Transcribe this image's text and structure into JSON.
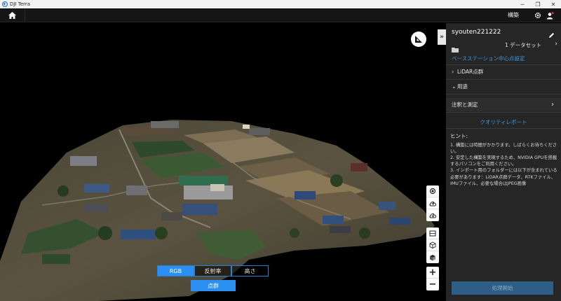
{
  "window": {
    "title": "DJI Terra",
    "icon": "dji-terra-logo-icon",
    "controls": [
      "minimize-icon",
      "restore-icon",
      "close-icon"
    ]
  },
  "topbar": {
    "home_icon": "home-icon",
    "menu_label": "構築",
    "settings_icon": "gear-icon",
    "account_icon": "user-icon",
    "notification_dot_color": "#e53935"
  },
  "viewport": {
    "compass_icon": "compass-icon",
    "collapse_label": "»",
    "view_tools": [
      "layers-icon",
      "cloud-upload-icon",
      "cloud-download-icon"
    ],
    "edit_tools": [
      "crop-icon",
      "cube-icon",
      "cube-solid-icon"
    ],
    "zoom_in_label": "+",
    "zoom_out_label": "−",
    "modes": [
      "RGB",
      "反射率",
      "高さ"
    ],
    "active_mode": "RGB",
    "pointcloud_label": "点群"
  },
  "panel": {
    "mission_name": "syouten221222",
    "edit_icon": "pencil-icon",
    "folder_icon": "folder-icon",
    "dataset_label": "1 データセット",
    "base_station_link": "ベースステーション中心点設定",
    "sections": [
      {
        "label": "LiDAR点群",
        "expanded": false
      },
      {
        "label": "用途",
        "expanded": true
      },
      {
        "label": "注釈と測定",
        "expanded": false
      }
    ],
    "quality_report_link": "クオリティレポート",
    "hint_title": "ヒント:",
    "hints": [
      "1. 構築には時間がかかります。しばらくお待ちください。",
      "2. 安定した構築を実現するため、NVIDIA GPUを搭載するパソコンをご利用ください。",
      "3. インポート用のフォルダーには以下が含まれている必要があります：LiDAR点群データ、RTKファイル、IMUファイル、必要な場合はJPEG画像"
    ],
    "start_button": "処理開始"
  },
  "colors": {
    "accent": "#2a8ff0",
    "link": "#3e9be8",
    "panel_bg": "#262626",
    "disabled_button": "#2e5d86"
  }
}
